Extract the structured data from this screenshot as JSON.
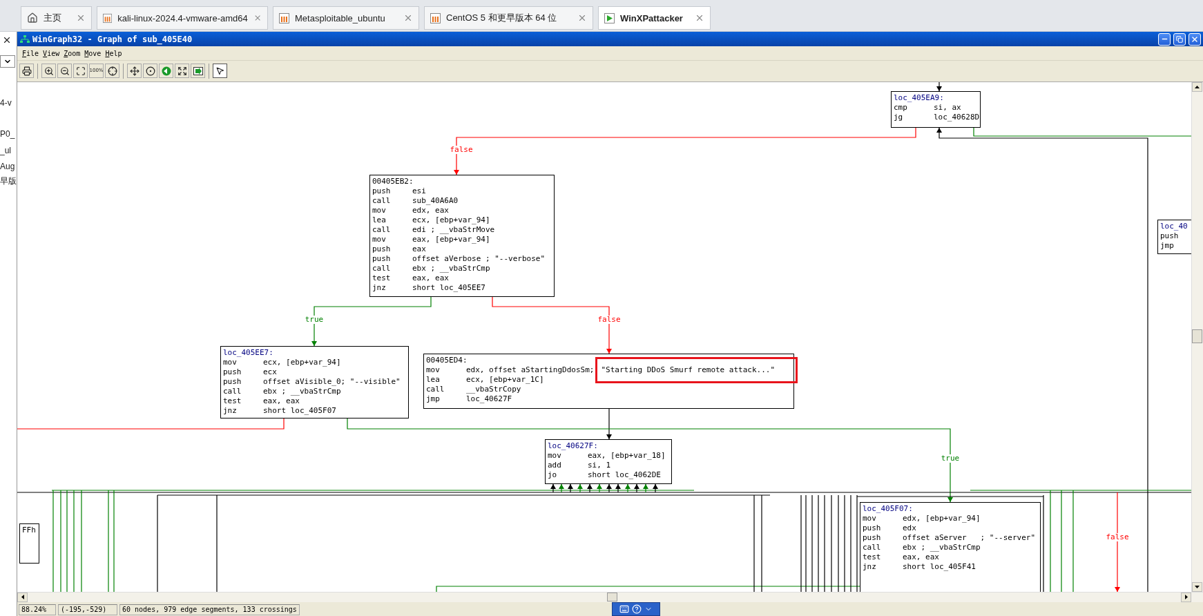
{
  "browser_tabs": [
    {
      "label": "主页",
      "kind": "home",
      "selected": false
    },
    {
      "label": "kali-linux-2024.4-vmware-amd64",
      "kind": "vm",
      "selected": false
    },
    {
      "label": "Metasploitable_ubuntu",
      "kind": "vm",
      "selected": false
    },
    {
      "label": "CentOS 5 和更早版本 64 位",
      "kind": "vm",
      "selected": false
    },
    {
      "label": "WinXPattacker",
      "kind": "vm-running",
      "selected": true
    }
  ],
  "side_panel": {
    "fragments": [
      "4-v",
      "P0_",
      "_ul",
      "Aug",
      "早版"
    ]
  },
  "window": {
    "title": "WinGraph32 - Graph of sub_405E40"
  },
  "menu": [
    "File",
    "View",
    "Zoom",
    "Move",
    "Help"
  ],
  "toolbar": {
    "zoom_label": "100%"
  },
  "graph": {
    "nodes": [
      {
        "header": "loc_405EA9:",
        "kind": "name",
        "lines": [
          {
            "op": "cmp",
            "args": "si, ax"
          },
          {
            "op": "jg",
            "args": "loc_40628D"
          }
        ]
      },
      {
        "header": "00405EB2:",
        "kind": "address",
        "lines": [
          {
            "op": "push",
            "args": "esi"
          },
          {
            "op": "call",
            "args": "sub_40A6A0"
          },
          {
            "op": "mov",
            "args": "edx, eax"
          },
          {
            "op": "lea",
            "args": "ecx, [ebp+var_94]"
          },
          {
            "op": "call",
            "args": "edi ; __vbaStrMove"
          },
          {
            "op": "mov",
            "args": "eax, [ebp+var_94]"
          },
          {
            "op": "push",
            "args": "eax"
          },
          {
            "op": "push",
            "args": "offset aVerbose ; \"--verbose\""
          },
          {
            "op": "call",
            "args": "ebx ; __vbaStrCmp"
          },
          {
            "op": "test",
            "args": "eax, eax"
          },
          {
            "op": "jnz",
            "args": "short loc_405EE7"
          }
        ]
      },
      {
        "header": "loc_40",
        "kind": "name",
        "lines": [
          {
            "op": "push"
          },
          {
            "op": "jmp"
          }
        ]
      },
      {
        "header": "loc_405EE7:",
        "kind": "name",
        "lines": [
          {
            "op": "mov",
            "args": "ecx, [ebp+var_94]"
          },
          {
            "op": "push",
            "args": "ecx"
          },
          {
            "op": "push",
            "args": "offset aVisible_0; \"--visible\""
          },
          {
            "op": "call",
            "args": "ebx ; __vbaStrCmp"
          },
          {
            "op": "test",
            "args": "eax, eax"
          },
          {
            "op": "jnz",
            "args": "short loc_405F07"
          }
        ]
      },
      {
        "header": "00405ED4:",
        "kind": "address",
        "lines": [
          {
            "op": "mov",
            "args": "edx, offset aStartingDdosSm;",
            "marked": "\"Starting DDoS Smurf remote attack...\""
          },
          {
            "op": "lea",
            "args": "ecx, [ebp+var_1C]"
          },
          {
            "op": "call",
            "args": "__vbaStrCopy"
          },
          {
            "op": "jmp",
            "args": "loc_40627F"
          }
        ]
      },
      {
        "header": "loc_40627F:",
        "kind": "name",
        "lines": [
          {
            "op": "mov",
            "args": "eax, [ebp+var_18]"
          },
          {
            "op": "add",
            "args": "si, 1"
          },
          {
            "op": "jo",
            "args": "short loc_4062DE"
          }
        ]
      },
      {
        "header": "loc_405F07:",
        "kind": "name",
        "lines": [
          {
            "op": "mov",
            "args": "edx, [ebp+var_94]"
          },
          {
            "op": "push",
            "args": "edx"
          },
          {
            "op": "push",
            "args": "offset aServer   ; \"--server\""
          },
          {
            "op": "call",
            "args": "ebx ; __vbaStrCmp"
          },
          {
            "op": "test",
            "args": "eax, eax"
          },
          {
            "op": "jnz",
            "args": "short loc_405F41"
          }
        ]
      },
      {
        "header": "FFh",
        "kind": "address"
      }
    ],
    "edge_labels": [
      {
        "text": "false",
        "color": "#ff0000"
      },
      {
        "text": "true",
        "color": "#008000"
      },
      {
        "text": "false",
        "color": "#ff0000"
      },
      {
        "text": "true",
        "color": "#008000"
      },
      {
        "text": "false",
        "color": "#ff0000"
      }
    ]
  },
  "status_bar": [
    "88.24%",
    "(-195,-529)",
    "60 nodes, 979 edge segments, 133 crossings"
  ]
}
